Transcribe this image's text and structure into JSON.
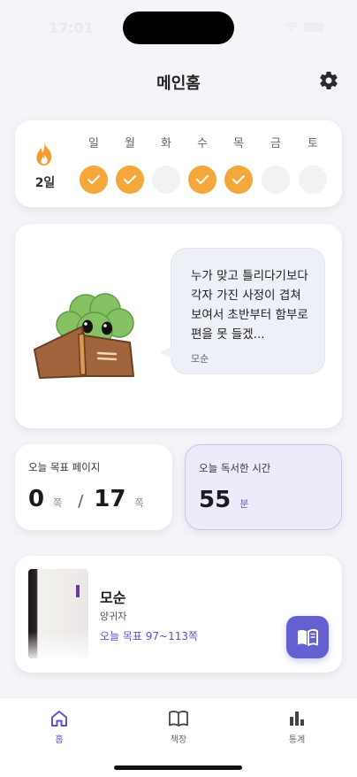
{
  "status_bar": {
    "time": "17:01"
  },
  "header": {
    "title": "메인홈",
    "settings_icon": "gear-icon"
  },
  "streak": {
    "count": "2일",
    "flame_color": "#f49a2e",
    "check_color": "#f4a73a",
    "days": [
      {
        "label": "일",
        "done": true
      },
      {
        "label": "월",
        "done": true
      },
      {
        "label": "화",
        "done": false
      },
      {
        "label": "수",
        "done": true
      },
      {
        "label": "목",
        "done": true
      },
      {
        "label": "금",
        "done": false
      },
      {
        "label": "토",
        "done": false
      }
    ]
  },
  "quote": {
    "text": "누가 맞고 틀리다기보다 각자 가진 사정이 겹쳐 보여서 초반부터 함부로 편을 못 들겠...",
    "source": "모순"
  },
  "today_goal": {
    "label": "오늘 목표 페이지",
    "current": "0",
    "current_unit": "쪽",
    "separator": "/",
    "target": "17",
    "target_unit": "쪽"
  },
  "today_time": {
    "label": "오늘 독서한 시간",
    "minutes": "55",
    "unit": "분"
  },
  "current_book": {
    "title": "모순",
    "author": "양귀자",
    "goal": "오늘 목표 97~113쪽",
    "action_icon": "open-book-icon"
  },
  "tab_bar": {
    "accent": "#5a52cc",
    "tabs": [
      {
        "label": "홈",
        "icon": "home-icon",
        "active": true
      },
      {
        "label": "책장",
        "icon": "bookshelf-icon",
        "active": false
      },
      {
        "label": "통계",
        "icon": "bar-chart-icon",
        "active": false
      }
    ]
  }
}
